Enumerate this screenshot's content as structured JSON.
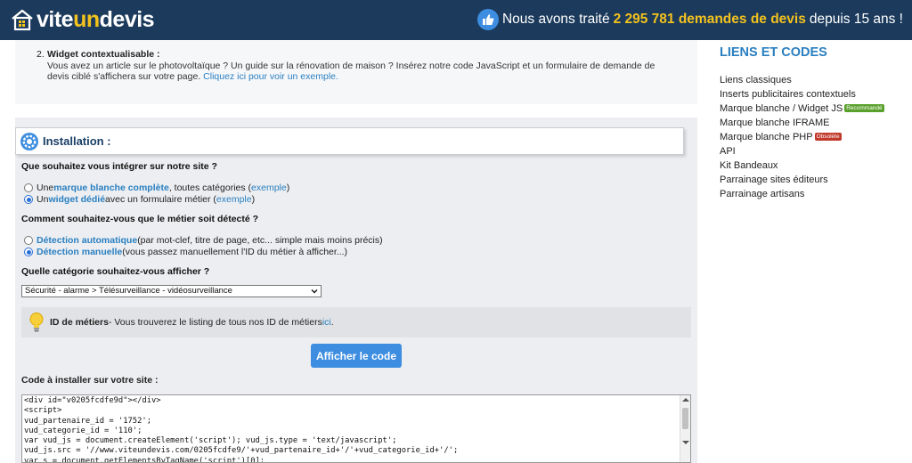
{
  "header": {
    "logo_white": "vite",
    "logo_yellow": "un",
    "logo_white2": "devis",
    "stats_prefix": "Nous avons traité",
    "stats_count": "2 295 781 demandes de devis",
    "stats_suffix": "depuis 15 ans !"
  },
  "widget_item": {
    "number": "2.",
    "title": "Widget contextualisable :",
    "text": "Vous avez un article sur le photovoltaïque ? Un guide sur la rénovation de maison ? Insérez notre code JavaScript et un formulaire de demande de devis ciblé s'affichera sur votre page.",
    "link": "Cliquez ici pour voir un exemple."
  },
  "installation": {
    "title": "Installation :",
    "q1": "Que souhaitez vous intégrer sur notre site ?",
    "q1_opt1": {
      "pre": "Une ",
      "bold": "marque blanche complète",
      "post": ", toutes catégories (",
      "link": "exemple",
      "end": ")"
    },
    "q1_opt2": {
      "pre": "Un ",
      "bold": "widget dédié",
      "post": " avec un formulaire métier (",
      "link": "exemple",
      "end": ")"
    },
    "q2": "Comment souhaitez-vous que le métier soit détecté ?",
    "q2_opt1": {
      "bold": "Détection automatique",
      "post": " (par mot-clef, titre de page, etc... simple mais moins précis)"
    },
    "q2_opt2": {
      "bold": "Détection manuelle",
      "post": " (vous passez manuellement l'ID du métier à afficher...)"
    },
    "q3": "Quelle catégorie souhaitez-vous afficher ?",
    "select_value": "Sécurité - alarme > Télésurveillance - vidéosurveillance",
    "info_bold": "ID de métiers",
    "info_text": " - Vous trouverez le listing de tous nos ID de métiers ",
    "info_link": "ici",
    "info_end": ".",
    "button": "Afficher le code",
    "code_label": "Code à installer sur votre site :",
    "code": "<div id=\"v0205fcdfe9d\"></div>\n<script>\nvud_partenaire_id = '1752';\nvud_categorie_id = '110';\nvar vud_js = document.createElement('script'); vud_js.type = 'text/javascript';\nvud_js.src = '//www.viteundevis.com/0205fcdfe9/'+vud_partenaire_id+'/'+vud_categorie_id+'/';\nvar s = document.getElementsByTagName('script')[0];"
  },
  "sidebar": {
    "title": "LIENS ET CODES",
    "items": [
      {
        "label": "Liens classiques"
      },
      {
        "label": "Inserts publicitaires contextuels"
      },
      {
        "label": "Marque blanche / Widget JS",
        "badge": "Recommandé",
        "badge_color": "#5aa02c"
      },
      {
        "label": "Marque blanche IFRAME"
      },
      {
        "label": "Marque blanche PHP",
        "badge": "Obsolète",
        "badge_color": "#c0392b"
      },
      {
        "label": "API"
      },
      {
        "label": "Kit Bandeaux"
      },
      {
        "label": "Parrainage sites éditeurs"
      },
      {
        "label": "Parrainage artisans"
      }
    ]
  }
}
